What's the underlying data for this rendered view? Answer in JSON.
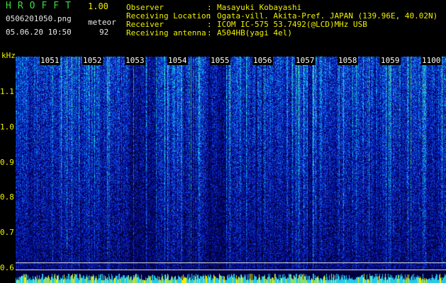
{
  "header": {
    "title": "HROFFT",
    "version": "1.00",
    "filename": "0506201050.png",
    "meteor_label": "meteor",
    "timestamp": "05.06.20 10:50",
    "meteor_count": "92"
  },
  "meta": [
    {
      "key": "Observer",
      "value": "Masayuki Kobayashi"
    },
    {
      "key": "Receiving Location",
      "value": "Ogata-vill. Akita-Pref. JAPAN (139.96E, 40.02N)"
    },
    {
      "key": "Receiver",
      "value": "ICOM IC-575 53.7492(@LCD)MHz USB"
    },
    {
      "key": "Receiving antenna",
      "value": "A504HB(yagi 4el)"
    }
  ],
  "separator": ":",
  "axis": {
    "y_unit": "kHz",
    "y_ticks": [
      "1.1",
      "1.0",
      "0.9",
      "0.8",
      "0.7",
      "0.6"
    ],
    "x_ticks": [
      "1051",
      "1052",
      "1053",
      "1054",
      "1055",
      "1056",
      "1057",
      "1058",
      "1059",
      "1100"
    ]
  },
  "colors": {
    "background": "#000000",
    "label_yellow": "#f0f000",
    "title_green": "#3cdc3c",
    "spectrum_low": "#0a1a8c",
    "spectrum_mid": "#1e64dc",
    "spectrum_high": "#28dca0"
  }
}
